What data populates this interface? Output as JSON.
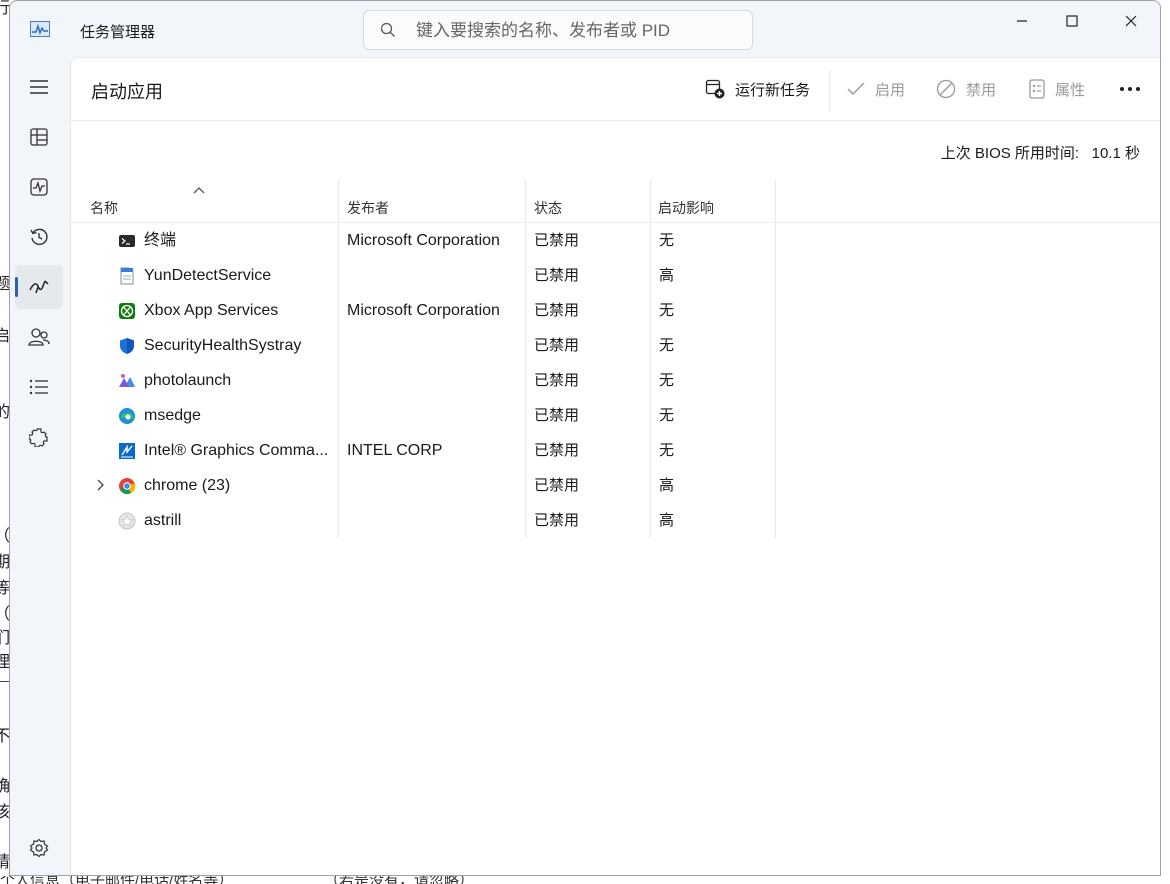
{
  "background_doc": {
    "left_glyphs": [
      "行",
      "题",
      "启",
      "的",
      "，",
      "：",
      "（",
      "期",
      "等",
      "（",
      "们",
      "理",
      "不",
      "确",
      "该",
      "请"
    ],
    "bottom_text": [
      "个人信息（电子邮件/电话/姓名等）",
      "（若是没有，请忽略）"
    ]
  },
  "window": {
    "title": "任务管理器",
    "search_placeholder": "键入要搜索的名称、发布者或 PID"
  },
  "nav": {
    "items": [
      {
        "name": "menu",
        "icon": "hamburger-icon"
      },
      {
        "name": "processes",
        "icon": "processes-icon"
      },
      {
        "name": "performance",
        "icon": "performance-icon"
      },
      {
        "name": "app-history",
        "icon": "history-icon"
      },
      {
        "name": "startup-apps",
        "icon": "startup-icon",
        "active": true
      },
      {
        "name": "users",
        "icon": "users-icon"
      },
      {
        "name": "details",
        "icon": "details-icon"
      },
      {
        "name": "services",
        "icon": "services-icon"
      },
      {
        "name": "settings",
        "icon": "gear-icon"
      }
    ]
  },
  "page": {
    "title": "启动应用",
    "commands": {
      "run_new_task": "运行新任务",
      "enable": "启用",
      "disable": "禁用",
      "properties": "属性"
    },
    "bios_label": "上次 BIOS 所用时间:",
    "bios_value": "10.1 秒"
  },
  "table": {
    "columns": {
      "name": "名称",
      "publisher": "发布者",
      "status": "状态",
      "impact": "启动影响"
    },
    "rows": [
      {
        "name": "终端",
        "publisher": "Microsoft Corporation",
        "status": "已禁用",
        "impact": "无",
        "icon": "terminal-icon"
      },
      {
        "name": "YunDetectService",
        "publisher": "",
        "status": "已禁用",
        "impact": "高",
        "icon": "document-icon"
      },
      {
        "name": "Xbox App Services",
        "publisher": "Microsoft Corporation",
        "status": "已禁用",
        "impact": "无",
        "icon": "xbox-icon"
      },
      {
        "name": "SecurityHealthSystray",
        "publisher": "",
        "status": "已禁用",
        "impact": "无",
        "icon": "shield-icon"
      },
      {
        "name": "photolaunch",
        "publisher": "",
        "status": "已禁用",
        "impact": "无",
        "icon": "photos-icon"
      },
      {
        "name": "msedge",
        "publisher": "",
        "status": "已禁用",
        "impact": "无",
        "icon": "edge-icon"
      },
      {
        "name": "Intel® Graphics Comma...",
        "publisher": "INTEL CORP",
        "status": "已禁用",
        "impact": "无",
        "icon": "intel-graphics-icon"
      },
      {
        "name": "chrome (23)",
        "publisher": "",
        "status": "已禁用",
        "impact": "高",
        "icon": "chrome-icon",
        "expandable": true
      },
      {
        "name": "astrill",
        "publisher": "",
        "status": "已禁用",
        "impact": "高",
        "icon": "astrill-icon"
      }
    ]
  }
}
